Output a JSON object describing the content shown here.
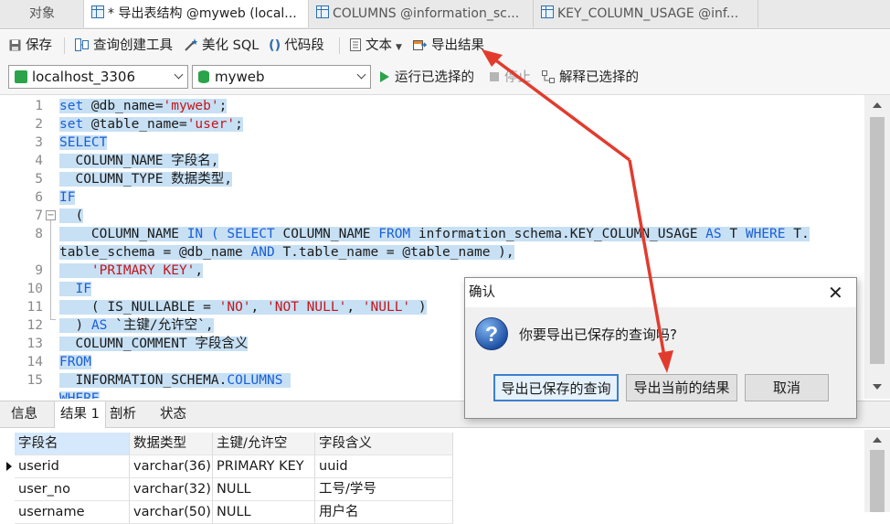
{
  "tabs": [
    {
      "label": "对象"
    },
    {
      "label": "* 导出表结构 @myweb (local..."
    },
    {
      "label": "COLUMNS @information_sc..."
    },
    {
      "label": "KEY_COLUMN_USAGE @inf..."
    }
  ],
  "toolbar": {
    "save": "保存",
    "query_builder": "查询创建工具",
    "beautify": "美化 SQL",
    "snippet": "代码段",
    "text": "文本",
    "export": "导出结果"
  },
  "connection": {
    "server": "localhost_3306",
    "database": "myweb",
    "run_selected": "运行已选择的",
    "stop": "停止",
    "explain_selected": "解释已选择的"
  },
  "editor": {
    "line_numbers": [
      "1",
      "2",
      "3",
      "4",
      "5",
      "6",
      "7",
      "",
      "8",
      "9",
      "10",
      "11",
      "12",
      "13",
      "14",
      "15"
    ],
    "plain": {
      "l2": "COLUMN_NAME 字段名,",
      "l3": "COLUMN_TYPE 数据类型,",
      "l6": "COLUMN_NAME ",
      "l6b": " COLUMN_NAME ",
      "l6c": " information_schema.KEY_COLUMN_USAGE ",
      "l6d": " T ",
      "l6e": " T.",
      "l7": "table_schema = @db_name ",
      "l7b": " T.table_name = @table_name ),",
      "l10": "( IS_NULLABLE = ",
      "l11": ") ",
      "l11b": " `主键/允许空`,",
      "l12": "COLUMN_COMMENT 字段含义",
      "l14": "INFORMATION_SCHEMA.",
      "set1": " @db_name=",
      "set2": " @table_name=",
      "paren": "(",
      "comma": ", ",
      "close": " )",
      "semi": ";",
      "comma_end": ","
    },
    "kw": {
      "set": "set",
      "select": "SELECT",
      "if": "IF",
      "in": "IN",
      "select2": "( SELECT",
      "from": "FROM",
      "as": "AS",
      "where": "WHERE",
      "and": "AND",
      "columns": "COLUMNS",
      "where_partial": "WHERE"
    },
    "str": {
      "myweb": "'myweb'",
      "user": "'user'",
      "pk": "'PRIMARY KEY'",
      "no": "'NO'",
      "notnull": "'NOT NULL'",
      "null": "'NULL'"
    }
  },
  "bottom_tabs": [
    "信息",
    "结果 1",
    "剖析",
    "状态"
  ],
  "grid": {
    "headers": [
      "字段名",
      "数据类型",
      "主键/允许空",
      "字段含义"
    ],
    "rows": [
      [
        "userid",
        "varchar(36)",
        "PRIMARY KEY",
        "uuid"
      ],
      [
        "user_no",
        "varchar(32)",
        "NULL",
        "工号/学号"
      ],
      [
        "username",
        "varchar(50)",
        "NULL",
        "用户名"
      ]
    ]
  },
  "dialog": {
    "title": "确认",
    "message": "你要导出已保存的查询吗?",
    "btn_saved": "导出已保存的查询",
    "btn_current": "导出当前的结果",
    "btn_cancel": "取消"
  },
  "colors": {
    "keyword": "#1a5fd8",
    "string": "#c4161c",
    "selection": "#c7e0f4",
    "annotation_arrow": "#e23b2e"
  }
}
